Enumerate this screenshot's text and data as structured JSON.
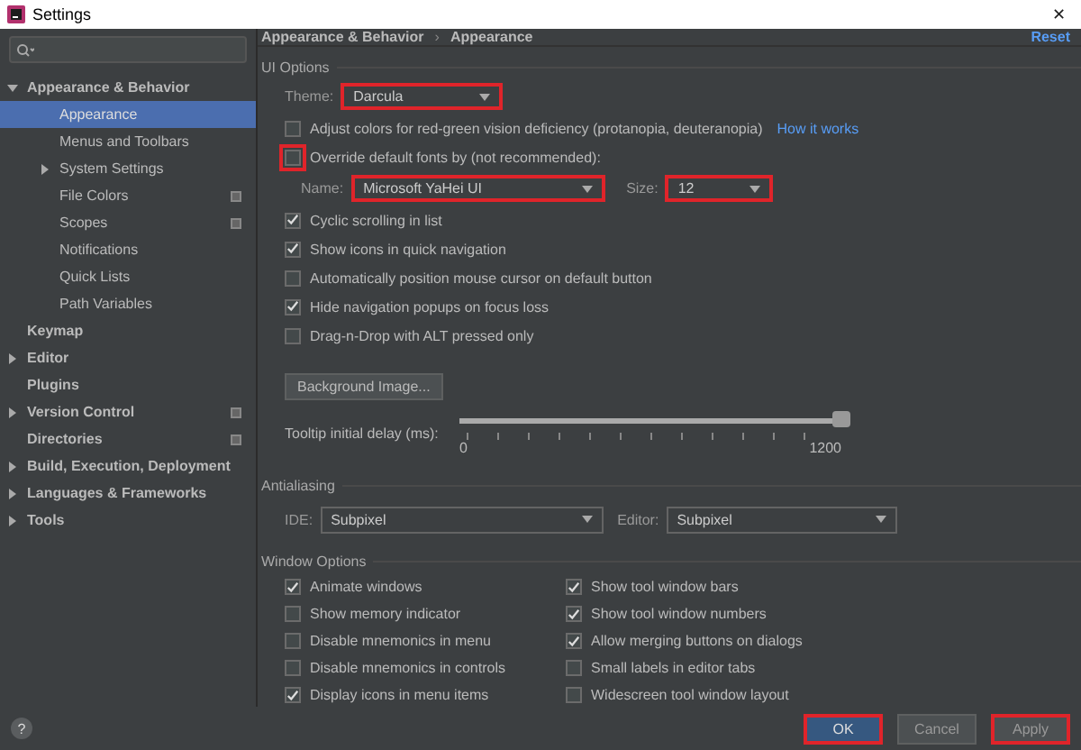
{
  "window": {
    "title": "Settings",
    "close": "✕"
  },
  "sidebar": {
    "items": [
      {
        "label": "Appearance & Behavior",
        "expanded": true,
        "selected": false,
        "children": [
          {
            "label": "Appearance",
            "selected": true
          },
          {
            "label": "Menus and Toolbars",
            "selected": false
          },
          {
            "label": "System Settings",
            "expanded": false,
            "selected": false
          },
          {
            "label": "File Colors",
            "selected": false,
            "project_level": true
          },
          {
            "label": "Scopes",
            "selected": false,
            "project_level": true
          },
          {
            "label": "Notifications",
            "selected": false
          },
          {
            "label": "Quick Lists",
            "selected": false
          },
          {
            "label": "Path Variables",
            "selected": false
          }
        ]
      },
      {
        "label": "Keymap",
        "selected": false
      },
      {
        "label": "Editor",
        "expanded": false,
        "selected": false
      },
      {
        "label": "Plugins",
        "selected": false
      },
      {
        "label": "Version Control",
        "expanded": false,
        "selected": false,
        "project_level": true
      },
      {
        "label": "Directories",
        "selected": false,
        "project_level": true
      },
      {
        "label": "Build, Execution, Deployment",
        "expanded": false,
        "selected": false
      },
      {
        "label": "Languages & Frameworks",
        "expanded": false,
        "selected": false
      },
      {
        "label": "Tools",
        "expanded": false,
        "selected": false
      }
    ]
  },
  "breadcrumb": {
    "parts": [
      "Appearance & Behavior",
      "Appearance"
    ],
    "separator": "›"
  },
  "reset": "Reset",
  "sections": [
    {
      "title": "UI Options",
      "items": [
        {
          "kind": "select",
          "fields": [
            {
              "label": "Theme:",
              "value": "Darcula",
              "highlighted": true
            }
          ]
        },
        {
          "kind": "checkbox",
          "label": "Adjust colors for red-green vision deficiency (protanopia, deuteranopia)",
          "checked": false,
          "link": "How it works"
        },
        {
          "kind": "checkbox",
          "label": "Override default fonts by (not recommended):",
          "checked": false,
          "highlighted": true
        },
        {
          "kind": "font",
          "fields": [
            {
              "label": "Name:",
              "value": "Microsoft YaHei UI",
              "highlighted": true
            },
            {
              "label": "Size:",
              "value": "12",
              "highlighted": true
            }
          ]
        },
        {
          "kind": "checkbox",
          "label": "Cyclic scrolling in list",
          "checked": true
        },
        {
          "kind": "checkbox",
          "label": "Show icons in quick navigation",
          "checked": true
        },
        {
          "kind": "checkbox",
          "label": "Automatically position mouse cursor on default button",
          "checked": false
        },
        {
          "kind": "checkbox",
          "label": "Hide navigation popups on focus loss",
          "checked": true
        },
        {
          "kind": "checkbox",
          "label": "Drag-n-Drop with ALT pressed only",
          "checked": false
        },
        {
          "kind": "button",
          "label": "Background Image..."
        },
        {
          "kind": "slider",
          "label": "Tooltip initial delay (ms):",
          "level": 1,
          "min": "0",
          "max": "1200"
        }
      ]
    },
    {
      "title": "Antialiasing",
      "items": [
        {
          "kind": "combos",
          "fields": [
            {
              "label": "IDE:",
              "value": "Subpixel",
              "highlighted": false
            },
            {
              "label": "Editor:",
              "value": "Subpixel",
              "highlighted": false
            }
          ]
        }
      ]
    },
    {
      "title": "Window Options",
      "items": [
        {
          "kind": "grid",
          "checks": [
            {
              "label": "Animate windows",
              "checked": true
            },
            {
              "label": "Show tool window bars",
              "checked": true
            },
            {
              "label": "Show memory indicator",
              "checked": false
            },
            {
              "label": "Show tool window numbers",
              "checked": true
            },
            {
              "label": "Disable mnemonics in menu",
              "checked": false
            },
            {
              "label": "Allow merging buttons on dialogs",
              "checked": true
            },
            {
              "label": "Disable mnemonics in controls",
              "checked": false
            },
            {
              "label": "Small labels in editor tabs",
              "checked": false
            },
            {
              "label": "Display icons in menu items",
              "checked": true
            },
            {
              "label": "Widescreen tool window layout",
              "checked": false
            }
          ]
        }
      ]
    }
  ],
  "footer": {
    "help": "?",
    "buttons": [
      {
        "label": "OK",
        "kind": "primary",
        "highlighted": true
      },
      {
        "label": "Cancel",
        "kind": "plain",
        "highlighted": false
      },
      {
        "label": "Apply",
        "kind": "plain",
        "highlighted": true
      }
    ]
  }
}
